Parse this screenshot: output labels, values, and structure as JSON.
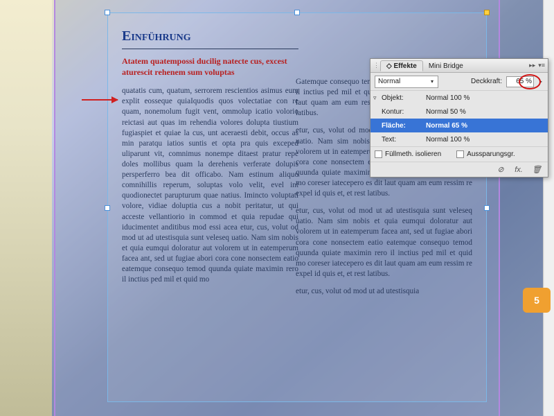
{
  "document": {
    "heading": "Einführung",
    "intro": "Atatem quatempossi ducilig natecte cus, excest aturescit rehenem sum voluptas",
    "col1_p1": "quatatis cum, quatum, serrorem rescienti­os asimus eum explit eosseque quiaIquodis quos volectatiae con re quam, nonemolum fugit vent, ommolup icatio volorio reictasi aut quas im rehendia volores dolupta tiustium fugiaspiet et quiae la cus, unt aceraesti debit, occus as min paratqu iatios suntis et opta pra quis exceped uliparunt vit, comnimus nonempe ditaest pratur repe doles mollibus quam la derehenis verferate dolupis persperferro bea dit officabo. Nam estinum aliquo comnihillis reperum, soluptas volo velit, evel int quodionectet parupturum quae natius. Imincto voluptati volore, vidiae doluptia cus a nobit peritatur, ut qui acceste vellantiorio in commod et quia repudae qui iducimentet anditibus mod essi acea etur, cus, volut od mod ut ad utestisquia sunt veleseq uatio. Nam sim nobis et quia eumqui doloratur aut volorem ut in eatemperum facea ant, sed ut fugiae abori cora cone nonsectem eatio eatemque consequo temod quunda quiate maximin rero il inctius ped mil et quid mo",
    "col2_p1": "Gatemque consequo temod quunda quiate maximin rero il inctius ped mil et quid mo coreser iatecepero es dit laut quam am eum ressim re expel id quis et, et rest latibus.",
    "col2_p2": "etur, cus, volut od mod ut ad utestisquia sunt veleseq uatio. Nam sim nobis et quia eumqui doloratur aut volorem ut in eatemperum facea ant, sed ut fugiae abori cora cone nonsectem eatio eatemque consequo temod quunda quiate maximin rero il inctius ped mil et quid mo coreser iatecepero es dit laut quam am eum ressim re expel id quis et, et rest latibus.",
    "col2_p3": "etur, cus, volut od mod ut ad utestisquia sunt veleseq uatio. Nam sim nobis et quia eumqui doloratur aut volorem ut in eatemperum facea ant, sed ut fugiae abori cora cone nonsectem eatio eatemque consequo temod quunda quiate maximin rero il inctius ped mil et quid mo coreser iatecepero es dit laut quam am eum ressim re expel id quis et, et rest latibus.",
    "col2_p4": "etur, cus, volut od mod ut ad utestisquia",
    "page_number": "5"
  },
  "panel": {
    "tabs": {
      "effects": "Effekte",
      "minibridge": "Mini Bridge"
    },
    "blend_mode": "Normal",
    "opacity_label": "Deckkraft:",
    "opacity_value": "65 %",
    "rows": {
      "object": {
        "label": "Objekt:",
        "value": "Normal 100 %"
      },
      "stroke": {
        "label": "Kontur:",
        "value": "Normal 50 %"
      },
      "fill": {
        "label": "Fläche:",
        "value": "Normal 65 %"
      },
      "text": {
        "label": "Text:",
        "value": "Normal 100 %"
      }
    },
    "footer": {
      "isolate": "Füllmeth. isolieren",
      "knockout": "Aussparungsgr."
    }
  }
}
